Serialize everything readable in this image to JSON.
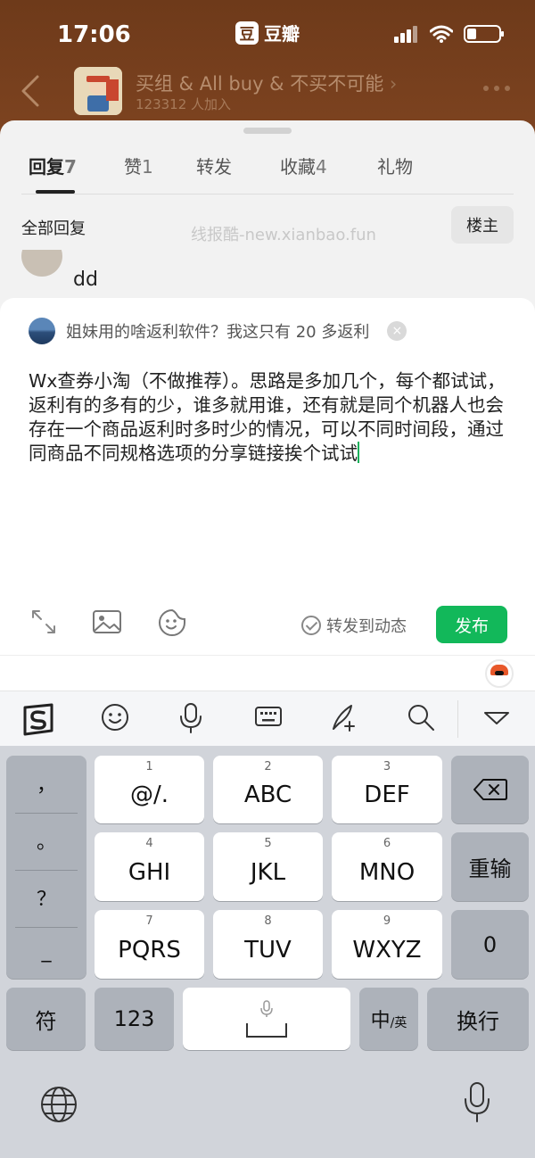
{
  "status_bar": {
    "time": "17:06",
    "app_name": "豆瓣",
    "app_logo_char": "豆"
  },
  "group": {
    "name": "买组 & All buy & 不买不可能",
    "member_count": "123312 人加入",
    "chevron": "›"
  },
  "tabs": [
    {
      "label": "回复",
      "count": "7",
      "active": true
    },
    {
      "label": "赞",
      "count": "1",
      "active": false
    },
    {
      "label": "转发",
      "count": "",
      "active": false
    },
    {
      "label": "收藏",
      "count": "4",
      "active": false
    },
    {
      "label": "礼物",
      "count": "",
      "active": false
    }
  ],
  "replies": {
    "section_label": "全部回复",
    "owner_filter": "楼主",
    "watermark": "线报酷-new.xianbao.fun",
    "partial_reply_text": "dd"
  },
  "compose": {
    "quote_text": "姐妹用的啥返利软件？我这只有 20 多返利",
    "quote_close": "×",
    "body_text": "Wx查券小淘（不做推荐）。思路是多加几个，每个都试试，返利有的多有的少，谁多就用谁，还有就是同个机器人也会存在一个商品返利时多时少的情况，可以不同时间段，通过同商品不同规格选项的分享链接挨个试试",
    "repost_label": "转发到动态",
    "publish_label": "发布"
  },
  "keyboard": {
    "punctuation": [
      "，",
      "。",
      "？",
      "_"
    ],
    "grid": [
      {
        "num": "1",
        "label": "@/."
      },
      {
        "num": "2",
        "label": "ABC"
      },
      {
        "num": "3",
        "label": "DEF"
      },
      {
        "num": "4",
        "label": "GHI"
      },
      {
        "num": "5",
        "label": "JKL"
      },
      {
        "num": "6",
        "label": "MNO"
      },
      {
        "num": "7",
        "label": "PQRS"
      },
      {
        "num": "8",
        "label": "TUV"
      },
      {
        "num": "9",
        "label": "WXYZ"
      }
    ],
    "reenter_label": "重输",
    "zero_label": "0",
    "symbols_label": "符",
    "numbers_label": "123",
    "lang_toggle_main": "中",
    "lang_toggle_sub": "/英",
    "return_label": "换行"
  },
  "colors": {
    "header_brown": "#7a3e1c",
    "accent_green": "#12b85a",
    "cursor_green": "#12b05a",
    "keyboard_bg": "#d1d4da"
  }
}
